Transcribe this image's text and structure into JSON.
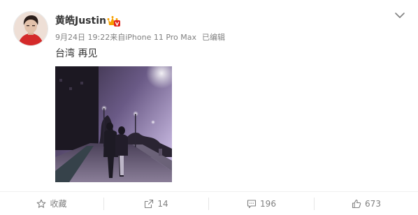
{
  "post": {
    "user_name": "黄皓Justin",
    "timestamp": "9月24日 19:22",
    "source": "来自iPhone 11 Pro Max",
    "edited": "已编辑",
    "text": "台湾 再见"
  },
  "actions": {
    "favorite_label": "收藏",
    "repost_count": "14",
    "comment_count": "196",
    "like_count": "673"
  },
  "icons": {
    "badge": "vip-crown-badge-icon",
    "menu": "chevron-down-icon",
    "favorite": "star-icon",
    "repost": "repost-icon",
    "comment": "comment-icon",
    "like": "thumbs-up-icon"
  },
  "colors": {
    "text": "#333333",
    "meta": "#808080",
    "badge": "#f7a000",
    "divider": "#f0f0f0"
  }
}
